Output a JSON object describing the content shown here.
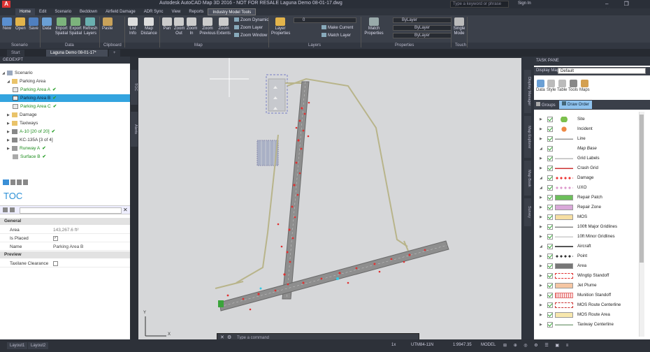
{
  "titlebar": {
    "app_icon": "A",
    "title": "Autodesk AutoCAD Map 3D 2016 - NOT FOR RESALE    Laguna Demo 08-01-17.dwg",
    "search_placeholder": "Type a keyword or phrase",
    "sign_in": "Sign In",
    "window_controls": "– ❐ ✕"
  },
  "ribbon_tabs": [
    "Home",
    "Edit",
    "Scenario",
    "Beddown",
    "Airfield Damage",
    "ADR Sync",
    "View",
    "Reports",
    "Industry Model Tools"
  ],
  "ribbon": {
    "buttons": {
      "new": "New",
      "open": "Open",
      "save": "Save",
      "data": "Data",
      "import_spatial": "Import Spatial",
      "export_spatial": "Export Spatial",
      "refresh_layers": "Refresh Layers",
      "paste": "Paste",
      "list_info": "List Info",
      "map_distance": "Map Distance",
      "pan": "Pan",
      "zoom_out": "Zoom Out",
      "zoom_in": "Zoom In",
      "zoom_previous": "Zoom Previous",
      "zoom_extents": "Zoom Extents",
      "zoom_dynamic": "Zoom Dynamic",
      "zoom_layer": "Zoom Layer",
      "zoom_window": "Zoom Window",
      "layer_properties": "Layer Properties",
      "layer_value": "0",
      "make_current": "Make Current",
      "match_layer": "Match Layer",
      "match_properties": "Match Properties",
      "bylayer1": "ByLayer",
      "bylayer2": "ByLayer",
      "bylayer3": "ByLayer",
      "single_mode": "Single Mode"
    },
    "panels": [
      "Scenario",
      "Data",
      "Clipboard",
      "Map",
      "Layers",
      "Properties",
      "Touch"
    ]
  },
  "doc_tabs": {
    "start": "Start",
    "active": "Laguna Demo 08-01-17*",
    "add": "+"
  },
  "left": {
    "header": "GEOEXPT",
    "tree": [
      {
        "label": "Scenario",
        "level": 0
      },
      {
        "label": "Parking Area",
        "level": 1
      },
      {
        "label": "Parking Area A",
        "level": 2
      },
      {
        "label": "Parking Area B",
        "level": 2
      },
      {
        "label": "Parking Area C",
        "level": 2
      },
      {
        "label": "Damage",
        "level": 1
      },
      {
        "label": "Taxiways",
        "level": 1
      },
      {
        "label": "A-10 [20 of 20]",
        "level": 1
      },
      {
        "label": "KC-135A [3 of 4]",
        "level": 1
      },
      {
        "label": "Runway A",
        "level": 1
      },
      {
        "label": "Surface B",
        "level": 1
      }
    ],
    "toc_label": "TOC",
    "side_tabs": [
      "TOC",
      "Alerts"
    ],
    "props": {
      "general": "General",
      "rows": [
        {
          "k": "Area",
          "v": "143,267.6 ft²"
        },
        {
          "k": "Is Placed",
          "v": ""
        },
        {
          "k": "Name",
          "v": "Parking Area B"
        }
      ],
      "preview": "Preview",
      "preview_rows": [
        {
          "k": "Taxilane Clearance",
          "v": ""
        }
      ]
    }
  },
  "canvas": {
    "cmd_placeholder": "Type a command",
    "ucs_y": "Y",
    "ucs_x": "X"
  },
  "right": {
    "header": "TASK PANE",
    "display_map_label": "Display Map:",
    "display_map_value": "Default",
    "tools": [
      "Data",
      "Style",
      "Table",
      "Tools",
      "Maps"
    ],
    "groups": "Groups",
    "draw_order": "Draw Order",
    "side_tabs": [
      "Display Manager",
      "Map Explorer",
      "Map Book",
      "Survey"
    ],
    "layers": [
      {
        "name": "Site",
        "italic": false
      },
      {
        "name": "Incident",
        "italic": false
      },
      {
        "name": "Line",
        "italic": false
      },
      {
        "name": "Map Base",
        "italic": true
      },
      {
        "name": "Grid Labels",
        "italic": false
      },
      {
        "name": "Crash Grid",
        "italic": false
      },
      {
        "name": "Damage",
        "italic": false
      },
      {
        "name": "UXO",
        "italic": false
      },
      {
        "name": "Repair Patch",
        "italic": false
      },
      {
        "name": "Repair Zone",
        "italic": false
      },
      {
        "name": "MOS",
        "italic": false
      },
      {
        "name": "100ft Major Gridlines",
        "italic": false
      },
      {
        "name": "10ft Minor Gridlines",
        "italic": false
      },
      {
        "name": "Aircraft",
        "italic": false
      },
      {
        "name": "Point",
        "italic": false
      },
      {
        "name": "Area",
        "italic": false
      },
      {
        "name": "Wingtip Standoff",
        "italic": false
      },
      {
        "name": "Jet Plume",
        "italic": false
      },
      {
        "name": "Munition Standoff",
        "italic": false
      },
      {
        "name": "MOS Route Centerline",
        "italic": false
      },
      {
        "name": "MOS Route Area",
        "italic": false
      },
      {
        "name": "Taxiway Centerline",
        "italic": false
      }
    ]
  },
  "statusbar": {
    "tabs": [
      "Layout1",
      "Layout2"
    ],
    "coords": "1:9947.35",
    "model": "MODEL",
    "crs": "UTM84-11N",
    "scale": "1x"
  },
  "colors": {
    "selection": "#33a4df",
    "check": "#2aa02a",
    "toc_blue": "#2a8fd6"
  }
}
